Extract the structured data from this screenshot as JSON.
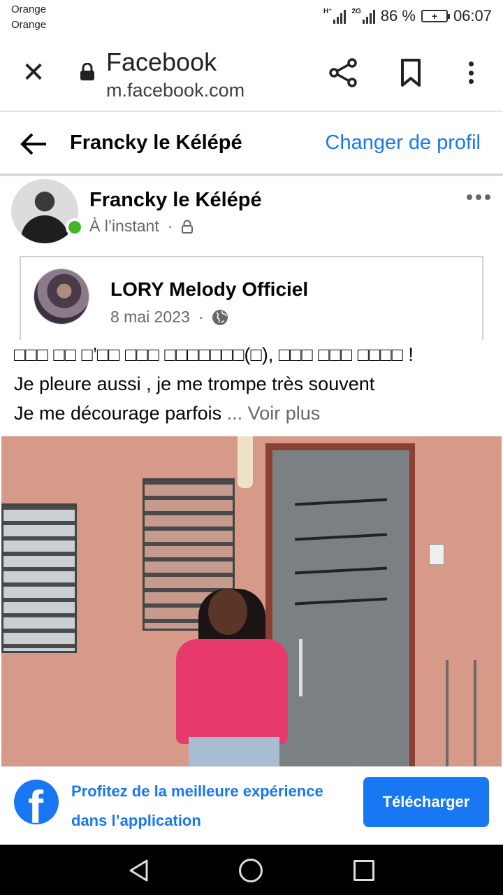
{
  "status_bar": {
    "carrier_1": "Orange",
    "carrier_2": "Orange",
    "network_1": "H⁺",
    "network_2": "2G",
    "battery_percent": "86 %",
    "time": "06:07"
  },
  "browser": {
    "title": "Facebook",
    "url": "m.facebook.com",
    "icons": [
      "close-icon",
      "lock-icon",
      "share-icon",
      "bookmark-icon",
      "more-vertical-icon"
    ]
  },
  "page_header": {
    "title": "Francky le Kélépé",
    "action": "Changer de profil"
  },
  "post": {
    "author": "Francky le Kélépé",
    "time": "À l’instant",
    "separator": "·",
    "shared": {
      "name": "LORY Melody Officiel",
      "date": "8 mai 2023",
      "separator": "·"
    },
    "text_lines": [
      "□□□ □□ □’□□ □□□ □□□□□□□(□), □□□ □□□ □□□□ !",
      "Je pleure aussi , je me trompe très souvent",
      "Je me décourage parfois"
    ],
    "ellipsis": " ...",
    "see_more": "Voir plus"
  },
  "app_banner": {
    "line_1": "Profitez de la meilleure expérience",
    "line_2": "dans l’application",
    "button": "Télécharger"
  },
  "colors": {
    "fb_blue": "#1877f2",
    "online_green": "#42b72a",
    "secondary_text": "#65676b"
  }
}
